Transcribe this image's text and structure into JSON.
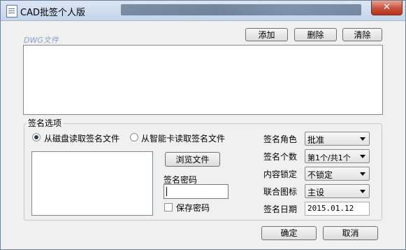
{
  "window": {
    "title": "CAD批签个人版",
    "close_glyph": "✕"
  },
  "toolbar": {
    "add_label": "添加",
    "delete_label": "删除",
    "clear_label": "清除"
  },
  "dwg_section": {
    "label": "DWG文件"
  },
  "signature_options": {
    "title": "签名选项",
    "radio_disk": {
      "label": "从磁盘读取签名文件",
      "selected": true
    },
    "radio_card": {
      "label": "从智能卡读取签名文件",
      "selected": false
    },
    "browse_label": "浏览文件",
    "password_label": "签名密码",
    "password_value": "",
    "save_password_label": "保存密码",
    "save_password_checked": false
  },
  "fields": [
    {
      "label": "签名角色",
      "value": "批准",
      "type": "combo"
    },
    {
      "label": "签名个数",
      "value": "第1个/共1个",
      "type": "combo"
    },
    {
      "label": "内容锁定",
      "value": "不锁定",
      "type": "combo"
    },
    {
      "label": "联合图标",
      "value": "主设",
      "type": "combo"
    },
    {
      "label": "签名日期",
      "value": "2015.01.12",
      "type": "text"
    }
  ],
  "footer": {
    "ok_label": "确定",
    "cancel_label": "取消"
  },
  "colors": {
    "dwg_label": "#8aa0c8",
    "close_button": "#c7503a",
    "radio_dot": "#2a3e60"
  }
}
